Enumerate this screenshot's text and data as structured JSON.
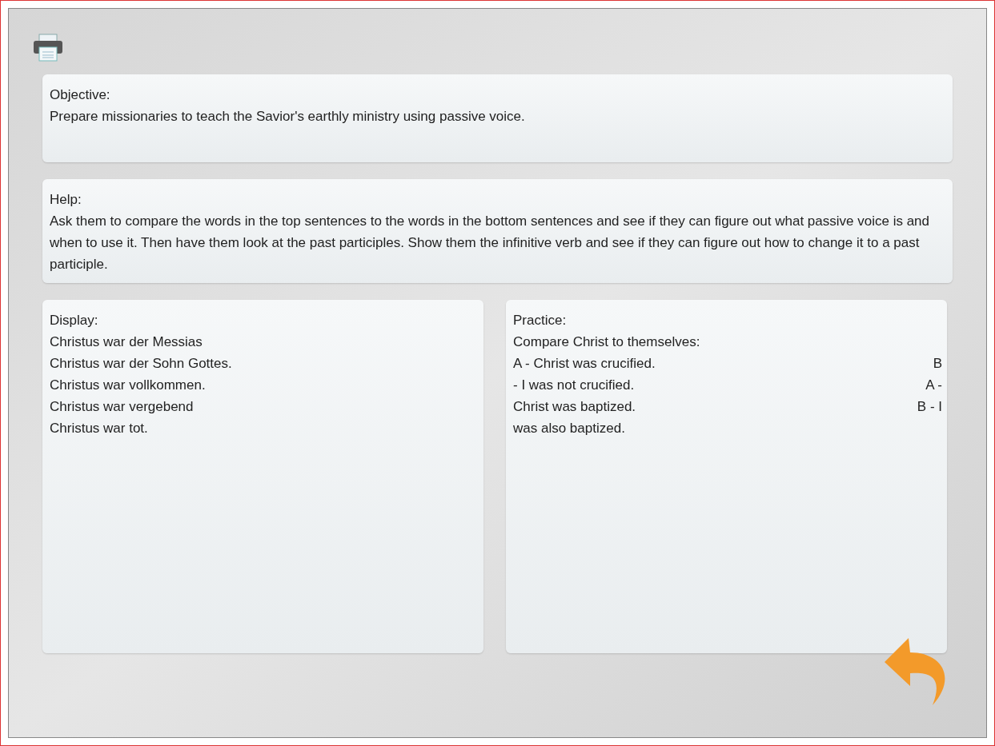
{
  "objective": {
    "heading": "Objective:",
    "text": "Prepare missionaries to teach the Savior's earthly ministry using passive voice."
  },
  "help": {
    "heading": "Help:",
    "text": "Ask them to compare the words in the top sentences to the words in the bottom sentences and see if they can figure out what passive voice is and when to use it.  Then have them look at the past participles.  Show them the infinitive verb and see if they can figure out how to change it to a past participle."
  },
  "display": {
    "heading": "Display:",
    "lines": [
      "Christus war der Messias",
      "Christus war der Sohn Gottes.",
      "Christus war vollkommen.",
      "Christus war vergebend",
      "Christus war tot."
    ]
  },
  "practice": {
    "heading": "Practice:",
    "lines": [
      {
        "text": "Compare Christ to themselves:"
      },
      {
        "text": "A - Christ was crucified.",
        "right": "B"
      },
      {
        "text": "- I was not crucified.",
        "right": "A -"
      },
      {
        "text": "Christ was baptized.",
        "right": "B - I"
      },
      {
        "text": "was also baptized."
      }
    ]
  }
}
